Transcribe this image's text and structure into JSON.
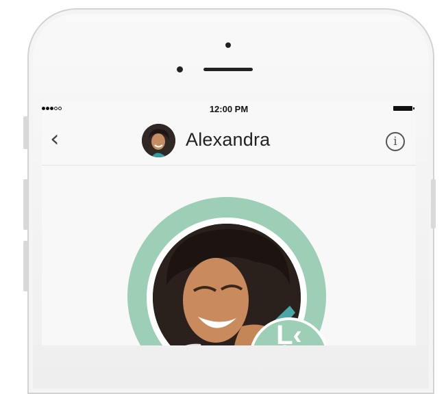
{
  "status_bar": {
    "time": "12:00 PM",
    "signal_filled": 3,
    "signal_total": 5
  },
  "nav": {
    "back_icon": "chevron-left-icon",
    "contact_name": "Alexandra",
    "info_icon": "info-icon",
    "info_glyph": "i"
  },
  "profile": {
    "ring_color": "#9ccfb6",
    "badge_text": "Ļ‹"
  }
}
